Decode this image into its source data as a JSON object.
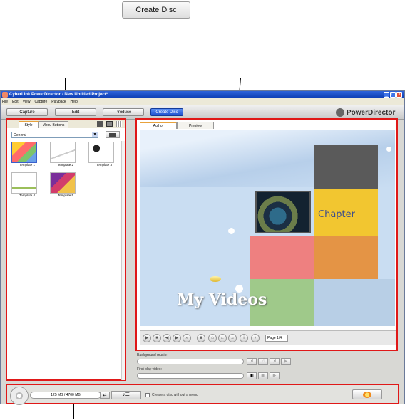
{
  "callout": {
    "create_disc_label": "Create Disc"
  },
  "window": {
    "title": "CyberLink PowerDirector - New Untitled Project*",
    "menu": [
      "File",
      "Edit",
      "View",
      "Capture",
      "Playback",
      "Help"
    ],
    "toolbar": {
      "capture": "Capture",
      "edit": "Edit",
      "produce": "Produce",
      "create_disc": "Create Disc"
    },
    "brand": "PowerDirector"
  },
  "left_panel": {
    "tabs": [
      "Style",
      "Menu Buttons"
    ],
    "category_select": "General",
    "templates": [
      "Template 1",
      "Template 2",
      "Template 3",
      "Template 4",
      "Template 5"
    ]
  },
  "right_panel": {
    "tabs": [
      "Author",
      "Preview"
    ],
    "canvas_title": "My Videos",
    "chapter_label": "Chapter",
    "page_indicator": "Page 1/4",
    "background_music_label": "Background music:",
    "first_play_video_label": "First play video:"
  },
  "bottom_bar": {
    "capacity": "125 MB / 4700 MB",
    "no_menu_label": "Create a disc without a menu"
  },
  "colors": {
    "highlight": "#e01818",
    "accent_blue": "#1e4fcf"
  }
}
